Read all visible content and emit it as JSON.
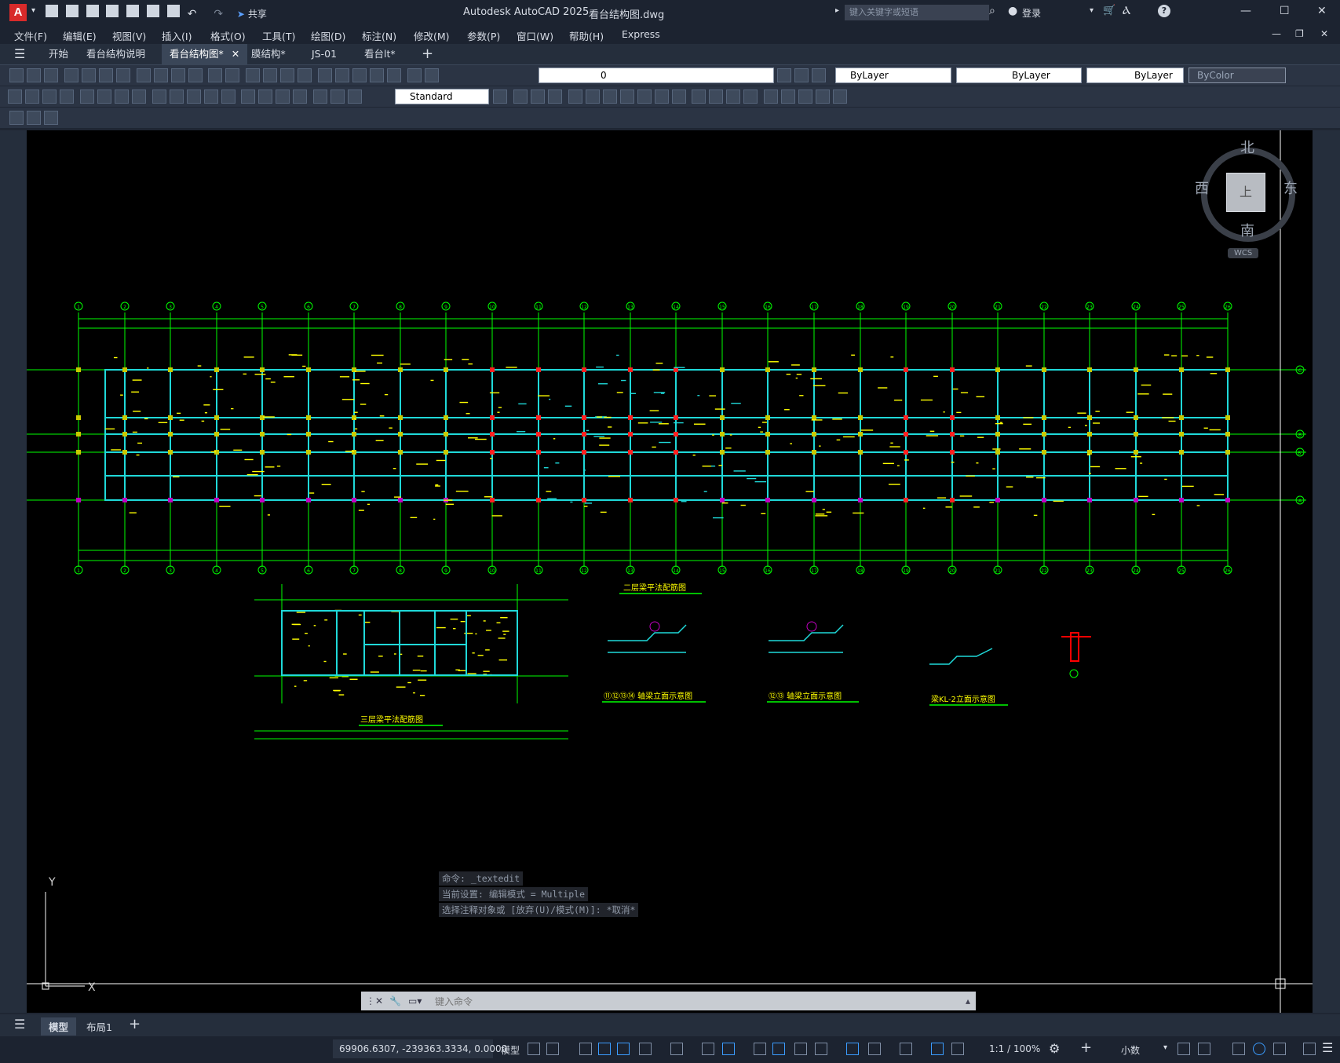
{
  "app": {
    "title": "Autodesk AutoCAD 2025",
    "file": "看台结构图.dwg",
    "share_label": "共享",
    "search_placeholder": "键入关键字或短语",
    "login_label": "登录",
    "logo_letter": "A"
  },
  "menu": [
    "文件(F)",
    "编辑(E)",
    "视图(V)",
    "插入(I)",
    "格式(O)",
    "工具(T)",
    "绘图(D)",
    "标注(N)",
    "修改(M)",
    "参数(P)",
    "窗口(W)",
    "帮助(H)",
    "Express"
  ],
  "doc_tabs": [
    {
      "label": "开始",
      "active": false
    },
    {
      "label": "看台结构说明",
      "active": false
    },
    {
      "label": "看台结构图*",
      "active": true
    },
    {
      "label": "膜结构*",
      "active": false
    },
    {
      "label": "JS-01",
      "active": false
    },
    {
      "label": "看台lt*",
      "active": false
    }
  ],
  "properties": {
    "layer": "0",
    "color": "ByLayer",
    "linetype": "ByLayer",
    "lineweight": "ByLayer",
    "plotstyle": "ByColor",
    "text_style": "Standard"
  },
  "viewcube": {
    "north": "北",
    "south": "南",
    "east": "东",
    "west": "西",
    "top": "上",
    "ucs": "WCS"
  },
  "drawing": {
    "grid_top": [
      "1",
      "2",
      "3",
      "4",
      "5",
      "6",
      "7",
      "8",
      "9",
      "10",
      "11",
      "12",
      "13",
      "14",
      "15",
      "16",
      "17",
      "18",
      "19",
      "20",
      "21",
      "22",
      "23",
      "24",
      "25",
      "26"
    ],
    "grid_side": [
      "C",
      "B",
      "B'",
      "A"
    ],
    "title_1": "二层梁平法配筋图",
    "title_2": "三层梁平法配筋图",
    "title_3": "⑪⑫⑬⑭ 轴梁立面示意图",
    "title_4": "⑫⑬ 轴梁立面示意图",
    "title_5": "梁KL-2立面示意图"
  },
  "command": {
    "history": [
      "命令: _textedit",
      "当前设置: 编辑模式 = Multiple",
      "选择注释对象或 [放弃(U)/模式(M)]: *取消*"
    ],
    "placeholder": "键入命令"
  },
  "layout_tabs": [
    {
      "label": "模型",
      "active": true
    },
    {
      "label": "布局1",
      "active": false
    }
  ],
  "status": {
    "coordinates": "69906.6307, -239363.3334, 0.0000",
    "mode": "模型",
    "scale": "1:1 / 100%",
    "units": "小数"
  },
  "axes": {
    "x": "X",
    "y": "Y"
  },
  "colors": {
    "grid_green": "#00ff00",
    "beam_cyan": "#1fd9d9",
    "annotation_yellow": "#ffff00",
    "column_red": "#ff0000",
    "purple": "#c000c0"
  }
}
